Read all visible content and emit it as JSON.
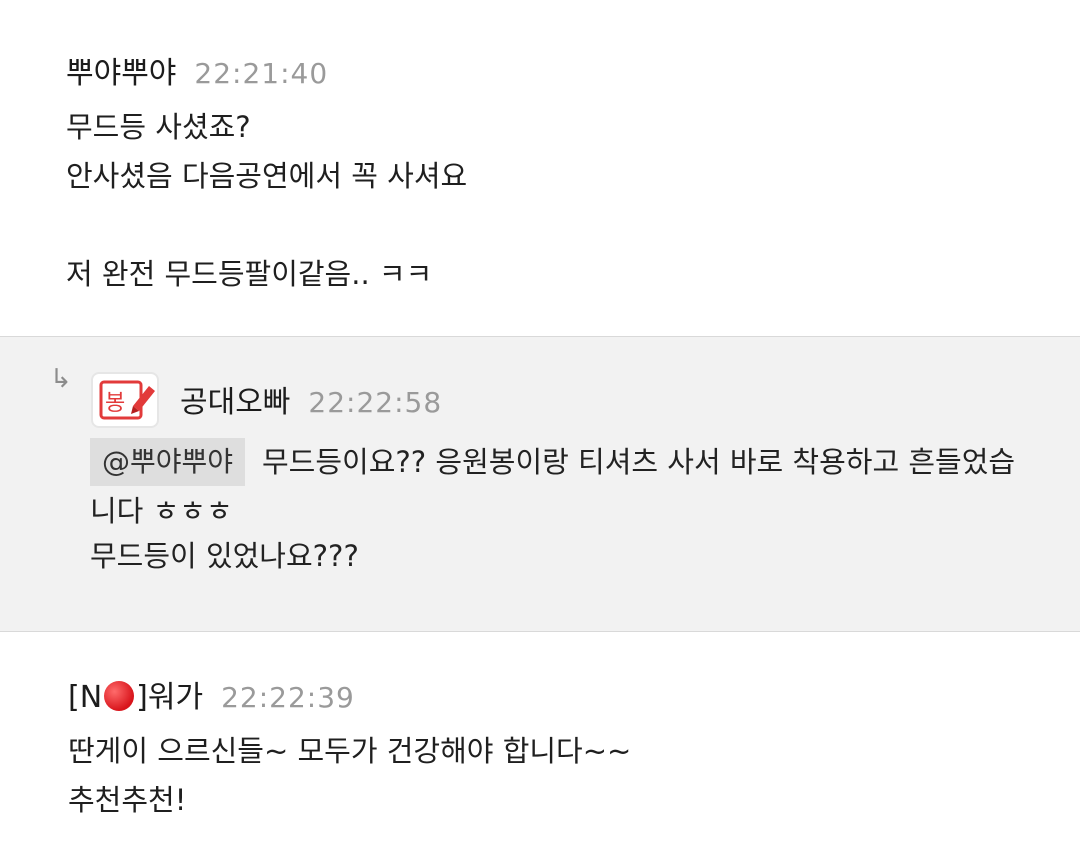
{
  "comments": [
    {
      "author": "뿌야뿌야",
      "time": "22:21:40",
      "text": "무드등 사셨죠?\n안사셨음 다음공연에서 꼭 사셔요\n\n저 완전 무드등팔이같음.. ㅋㅋ"
    },
    {
      "author": "공대오빠",
      "time": "22:22:58",
      "mention": "@뿌야뿌야",
      "line1": "무드등이요?? 응원봉이랑 티셔츠 사서 바로 착용하고 흔들었습",
      "line2": "니다 ㅎㅎㅎ",
      "line3": "무드등이 있었나요???",
      "avatar_text": "봉",
      "reply_icon": "reply-arrow-icon"
    },
    {
      "author_prefix": "[N",
      "author_suffix": "]워가",
      "time": "22:22:39",
      "text": "딴게이 으르신들~ 모두가 건강해야 합니다~~\n추천추천!"
    }
  ],
  "colors": {
    "reply_bg": "#f2f2f2",
    "time": "#9a9a9a",
    "avatar_red": "#e23a3a",
    "mention_bg": "#dedede"
  }
}
